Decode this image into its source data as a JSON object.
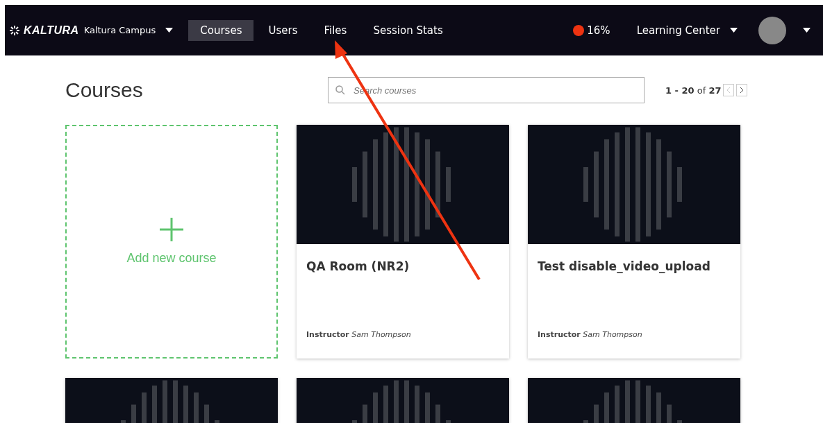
{
  "navbar": {
    "logo": "KALTURA",
    "campus": "Kaltura Campus",
    "tabs": [
      {
        "label": "Courses",
        "selected": true
      },
      {
        "label": "Users",
        "selected": false
      },
      {
        "label": "Files",
        "selected": false
      },
      {
        "label": "Session Stats",
        "selected": false
      }
    ],
    "status": {
      "reading": "16%",
      "color": "#ee3311"
    },
    "center": "Learning Center"
  },
  "page": {
    "title": "Courses",
    "search": {
      "placeholder": "Search courses"
    },
    "pager": "**1 - 20** of **27**"
  },
  "add_card": {
    "label": "Add new course"
  },
  "courses": [
    {
      "kind": "full",
      "title": "QA Room (NR2)",
      "instructor": "**Instructor** *Sam Thompson*"
    },
    {
      "kind": "full",
      "title": "Test disable_video_upload",
      "instructor": "**Instructor** *Sam Thompson*"
    },
    {
      "kind": "cut"
    },
    {
      "kind": "cut"
    },
    {
      "kind": "cut"
    }
  ]
}
